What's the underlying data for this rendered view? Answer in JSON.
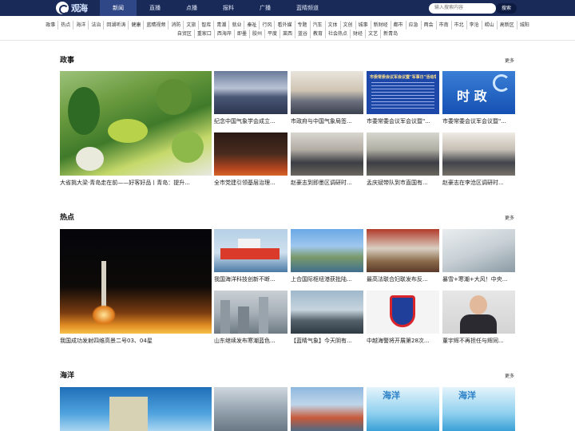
{
  "header": {
    "logo_text": "观海",
    "nav": [
      "新闻",
      "直播",
      "点播",
      "报料",
      "广播",
      "蓝睛频道"
    ],
    "active_nav": 0,
    "search_placeholder": "输入搜索内容",
    "search_button": "搜索"
  },
  "tags_row1": [
    "政事",
    "热点",
    "海洋",
    "法治",
    "回湖听涛",
    "健康",
    "蓝睛视频",
    "消防",
    "文旅",
    "智库",
    "青潮",
    "就业",
    "秦祉",
    "行风",
    "看外媒",
    "专题",
    "汽车",
    "文体",
    "文创",
    "城事",
    "新财经",
    "都市",
    "应急",
    "两会",
    "市南",
    "市北",
    "李沧",
    "崂山",
    "高新区",
    "城阳"
  ],
  "tags_row2": [
    "自贸区",
    "重家口",
    "西海岸",
    "即墨",
    "胶州",
    "平度",
    "莱西",
    "蓝谷",
    "教育",
    "社会热点",
    "财经",
    "文艺",
    "新青岛"
  ],
  "sections": [
    {
      "title": "政事",
      "more": "更多",
      "big_caption": "大省挑大梁·青岛走在前——好客好品丨青岛：提升...",
      "items": [
        {
          "caption": "纪念中国气象学会成立..."
        },
        {
          "caption": "市政府与中国气象局签..."
        },
        {
          "caption": "市委常委会议军会议暨\"...",
          "overlay": "市委常委会议军会议暨\"军事日\"活动举行"
        },
        {
          "caption": "市委常委会议军会议暨\"...",
          "overlay": "时 政"
        },
        {
          "caption": "全市党建引领基层治理..."
        },
        {
          "caption": "赵豪志到即墨区调研时..."
        },
        {
          "caption": "孟庆斌带队到市直国有..."
        },
        {
          "caption": "赵豪志在李沧区调研时..."
        }
      ]
    },
    {
      "title": "热点",
      "more": "更多",
      "big_caption": "我国成功发射四维高景二号03、04星",
      "items": [
        {
          "caption": "我国海洋科技创新不断..."
        },
        {
          "caption": "上合国际枢纽港获批陆..."
        },
        {
          "caption": "最高法联合妇联发布反..."
        },
        {
          "caption": "暴雪+寒潮+大风！中央..."
        },
        {
          "caption": "山东继续发布寒潮蓝色..."
        },
        {
          "caption": "【蓝睛气象】今天阴有..."
        },
        {
          "caption": "中越海警将开展第28次..."
        },
        {
          "caption": "董宇辉不再担任与辉同..."
        }
      ]
    },
    {
      "title": "海洋",
      "more": "更多",
      "items": [
        {},
        {},
        {},
        {
          "overlay": "海洋"
        },
        {
          "overlay": "海洋"
        }
      ]
    }
  ],
  "colors": {
    "topbar": "#1a2a58",
    "active_nav": "#2f4787"
  }
}
